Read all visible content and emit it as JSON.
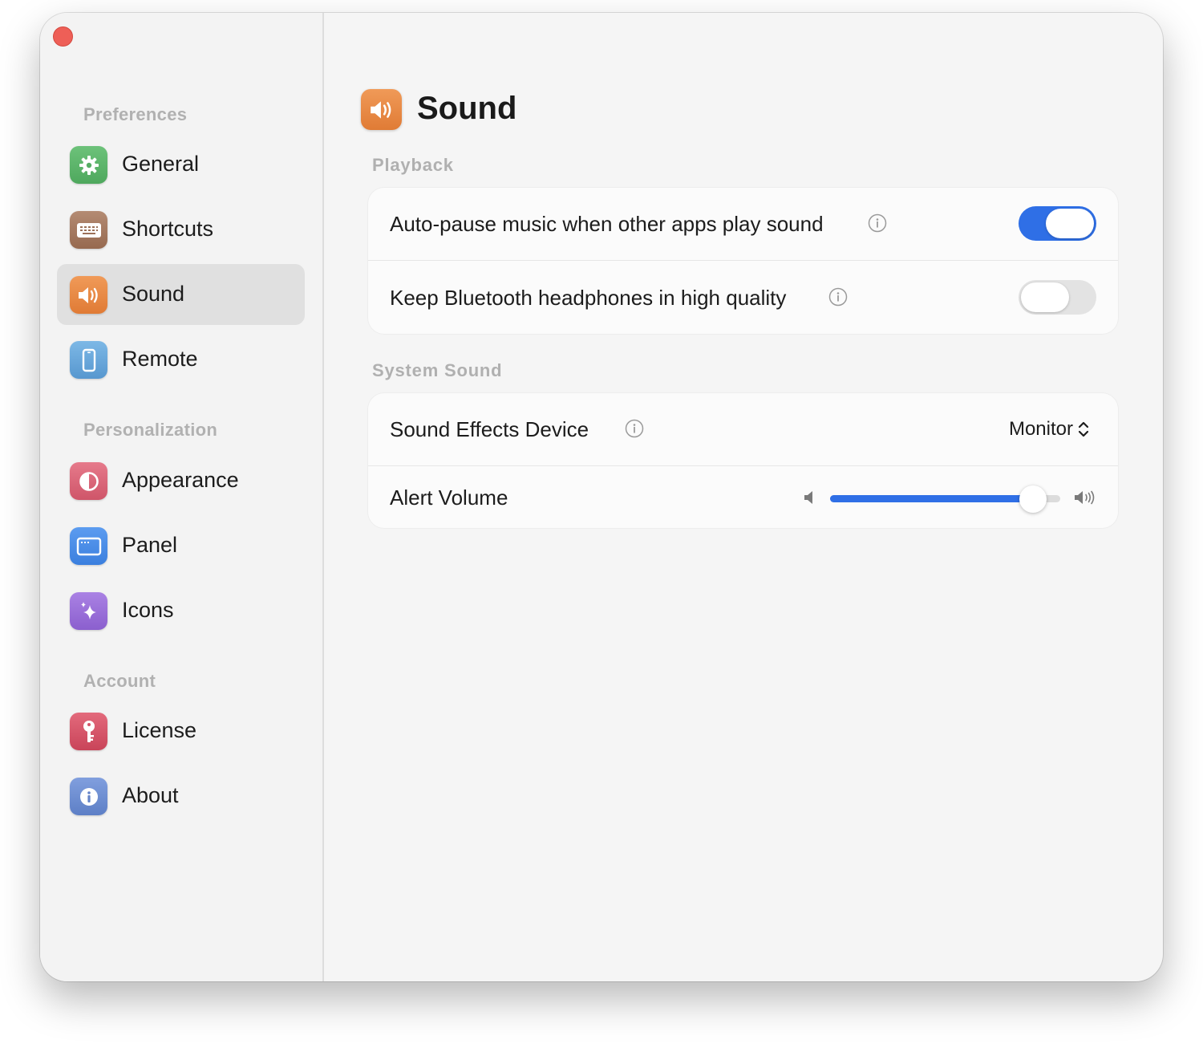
{
  "sidebar": {
    "sections": [
      {
        "title": "Preferences",
        "items": [
          {
            "label": "General",
            "icon": "gear-icon",
            "color": "#5fb56d"
          },
          {
            "label": "Shortcuts",
            "icon": "keyboard-icon",
            "color": "#a77b63"
          },
          {
            "label": "Sound",
            "icon": "speaker-icon",
            "color": "#e98a44",
            "active": true
          },
          {
            "label": "Remote",
            "icon": "phone-icon",
            "color": "#6aa9dc"
          }
        ]
      },
      {
        "title": "Personalization",
        "items": [
          {
            "label": "Appearance",
            "icon": "contrast-icon",
            "color": "#dc6478"
          },
          {
            "label": "Panel",
            "icon": "window-icon",
            "color": "#4b8ee8"
          },
          {
            "label": "Icons",
            "icon": "sparkle-icon",
            "color": "#9a6ed8"
          }
        ]
      },
      {
        "title": "Account",
        "items": [
          {
            "label": "License",
            "icon": "key-icon",
            "color": "#d9556b"
          },
          {
            "label": "About",
            "icon": "info-icon",
            "color": "#6f8ed4"
          }
        ]
      }
    ]
  },
  "page": {
    "title": "Sound",
    "icon": "speaker-icon",
    "color": "#e98a44"
  },
  "playback": {
    "title": "Playback",
    "auto_pause": {
      "label": "Auto-pause music when other apps play sound",
      "enabled": true
    },
    "bluetooth": {
      "label": "Keep Bluetooth headphones in high quality",
      "enabled": false
    }
  },
  "system_sound": {
    "title": "System Sound",
    "device": {
      "label": "Sound Effects Device",
      "value": "Monitor"
    },
    "alert_volume": {
      "label": "Alert Volume",
      "level": 0.88
    }
  },
  "colors": {
    "accent": "#2f6fe6"
  }
}
